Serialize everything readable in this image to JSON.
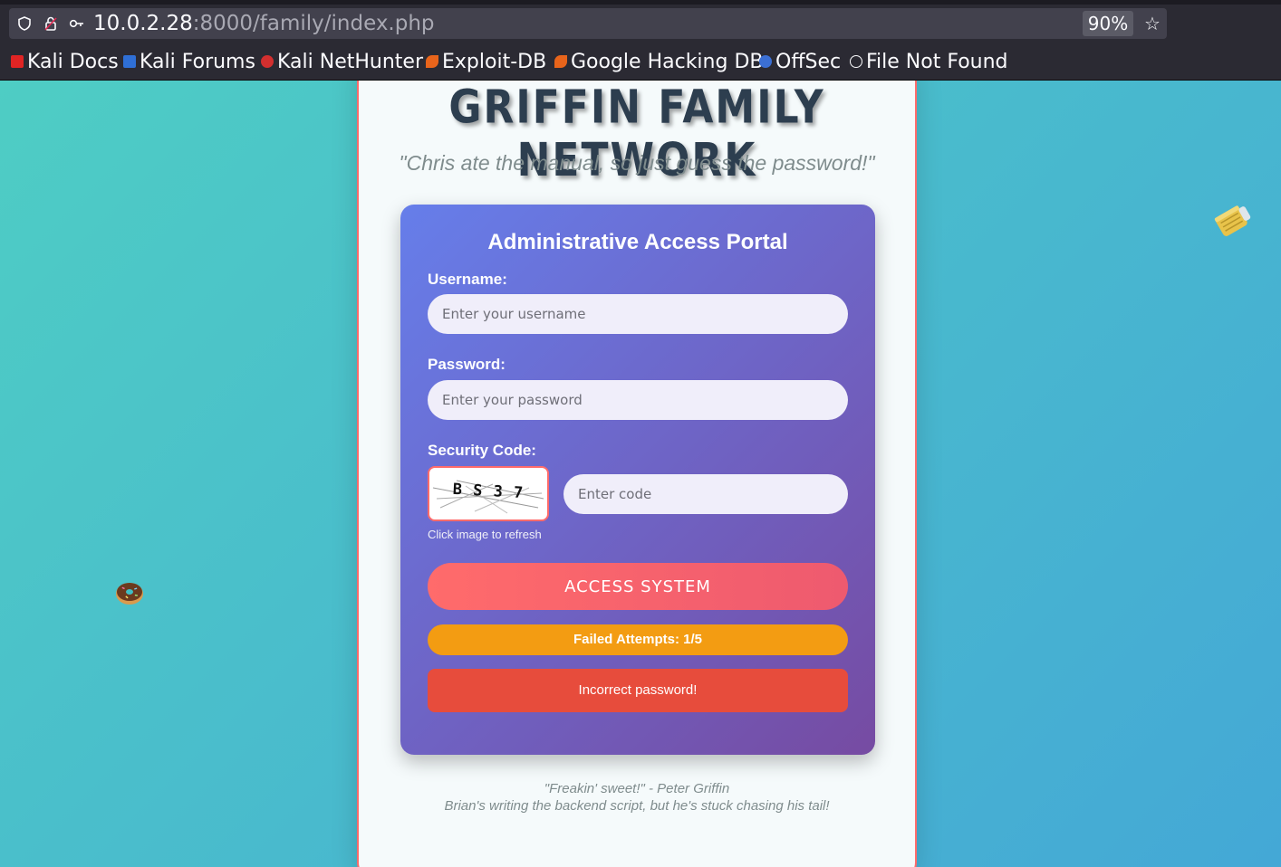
{
  "browser": {
    "url_host": "10.0.2.28",
    "url_path": ":8000/family/index.php",
    "zoom": "90%",
    "bookmarks": [
      {
        "label": "Kali Docs",
        "color": "#e02424"
      },
      {
        "label": "Kali Forums",
        "color": "#2f6fd6"
      },
      {
        "label": "Kali NetHunter",
        "color": "#d32f2f"
      },
      {
        "label": "Exploit-DB",
        "color": "#e8641b"
      },
      {
        "label": "Google Hacking DB",
        "color": "#e8641b"
      },
      {
        "label": "OffSec",
        "color": "#3b6fd4"
      },
      {
        "label": "File Not Found",
        "color": "#fbfbfe"
      }
    ]
  },
  "page": {
    "title": "GRIFFIN FAMILY NETWORK",
    "tagline": "\"Chris ate the manual, so just guess the password!\"",
    "portal": {
      "heading": "Administrative Access Portal",
      "username_label": "Username:",
      "username_placeholder": "Enter your username",
      "password_label": "Password:",
      "password_placeholder": "Enter your password",
      "security_label": "Security Code:",
      "captcha_text": "B S 3 7",
      "code_placeholder": "Enter code",
      "refresh_hint": "Click image to refresh",
      "submit_label": "ACCESS SYSTEM",
      "attempts_text": "Failed Attempts: 1/5",
      "error_text": "Incorrect password!"
    },
    "footer": {
      "quote": "\"Freakin' sweet!\" - Peter Griffin",
      "note": "Brian's writing the backend script, but he's stuck chasing his tail!"
    },
    "decorations": [
      "donut-icon",
      "beer-can-icon"
    ]
  },
  "colors": {
    "background_start": "#4ecdc4",
    "background_end": "#44a8d6",
    "portal_start": "#667eea",
    "portal_end": "#764ba2",
    "accent": "#ff6b6b",
    "warning": "#f39c12",
    "error": "#e74c3c"
  }
}
